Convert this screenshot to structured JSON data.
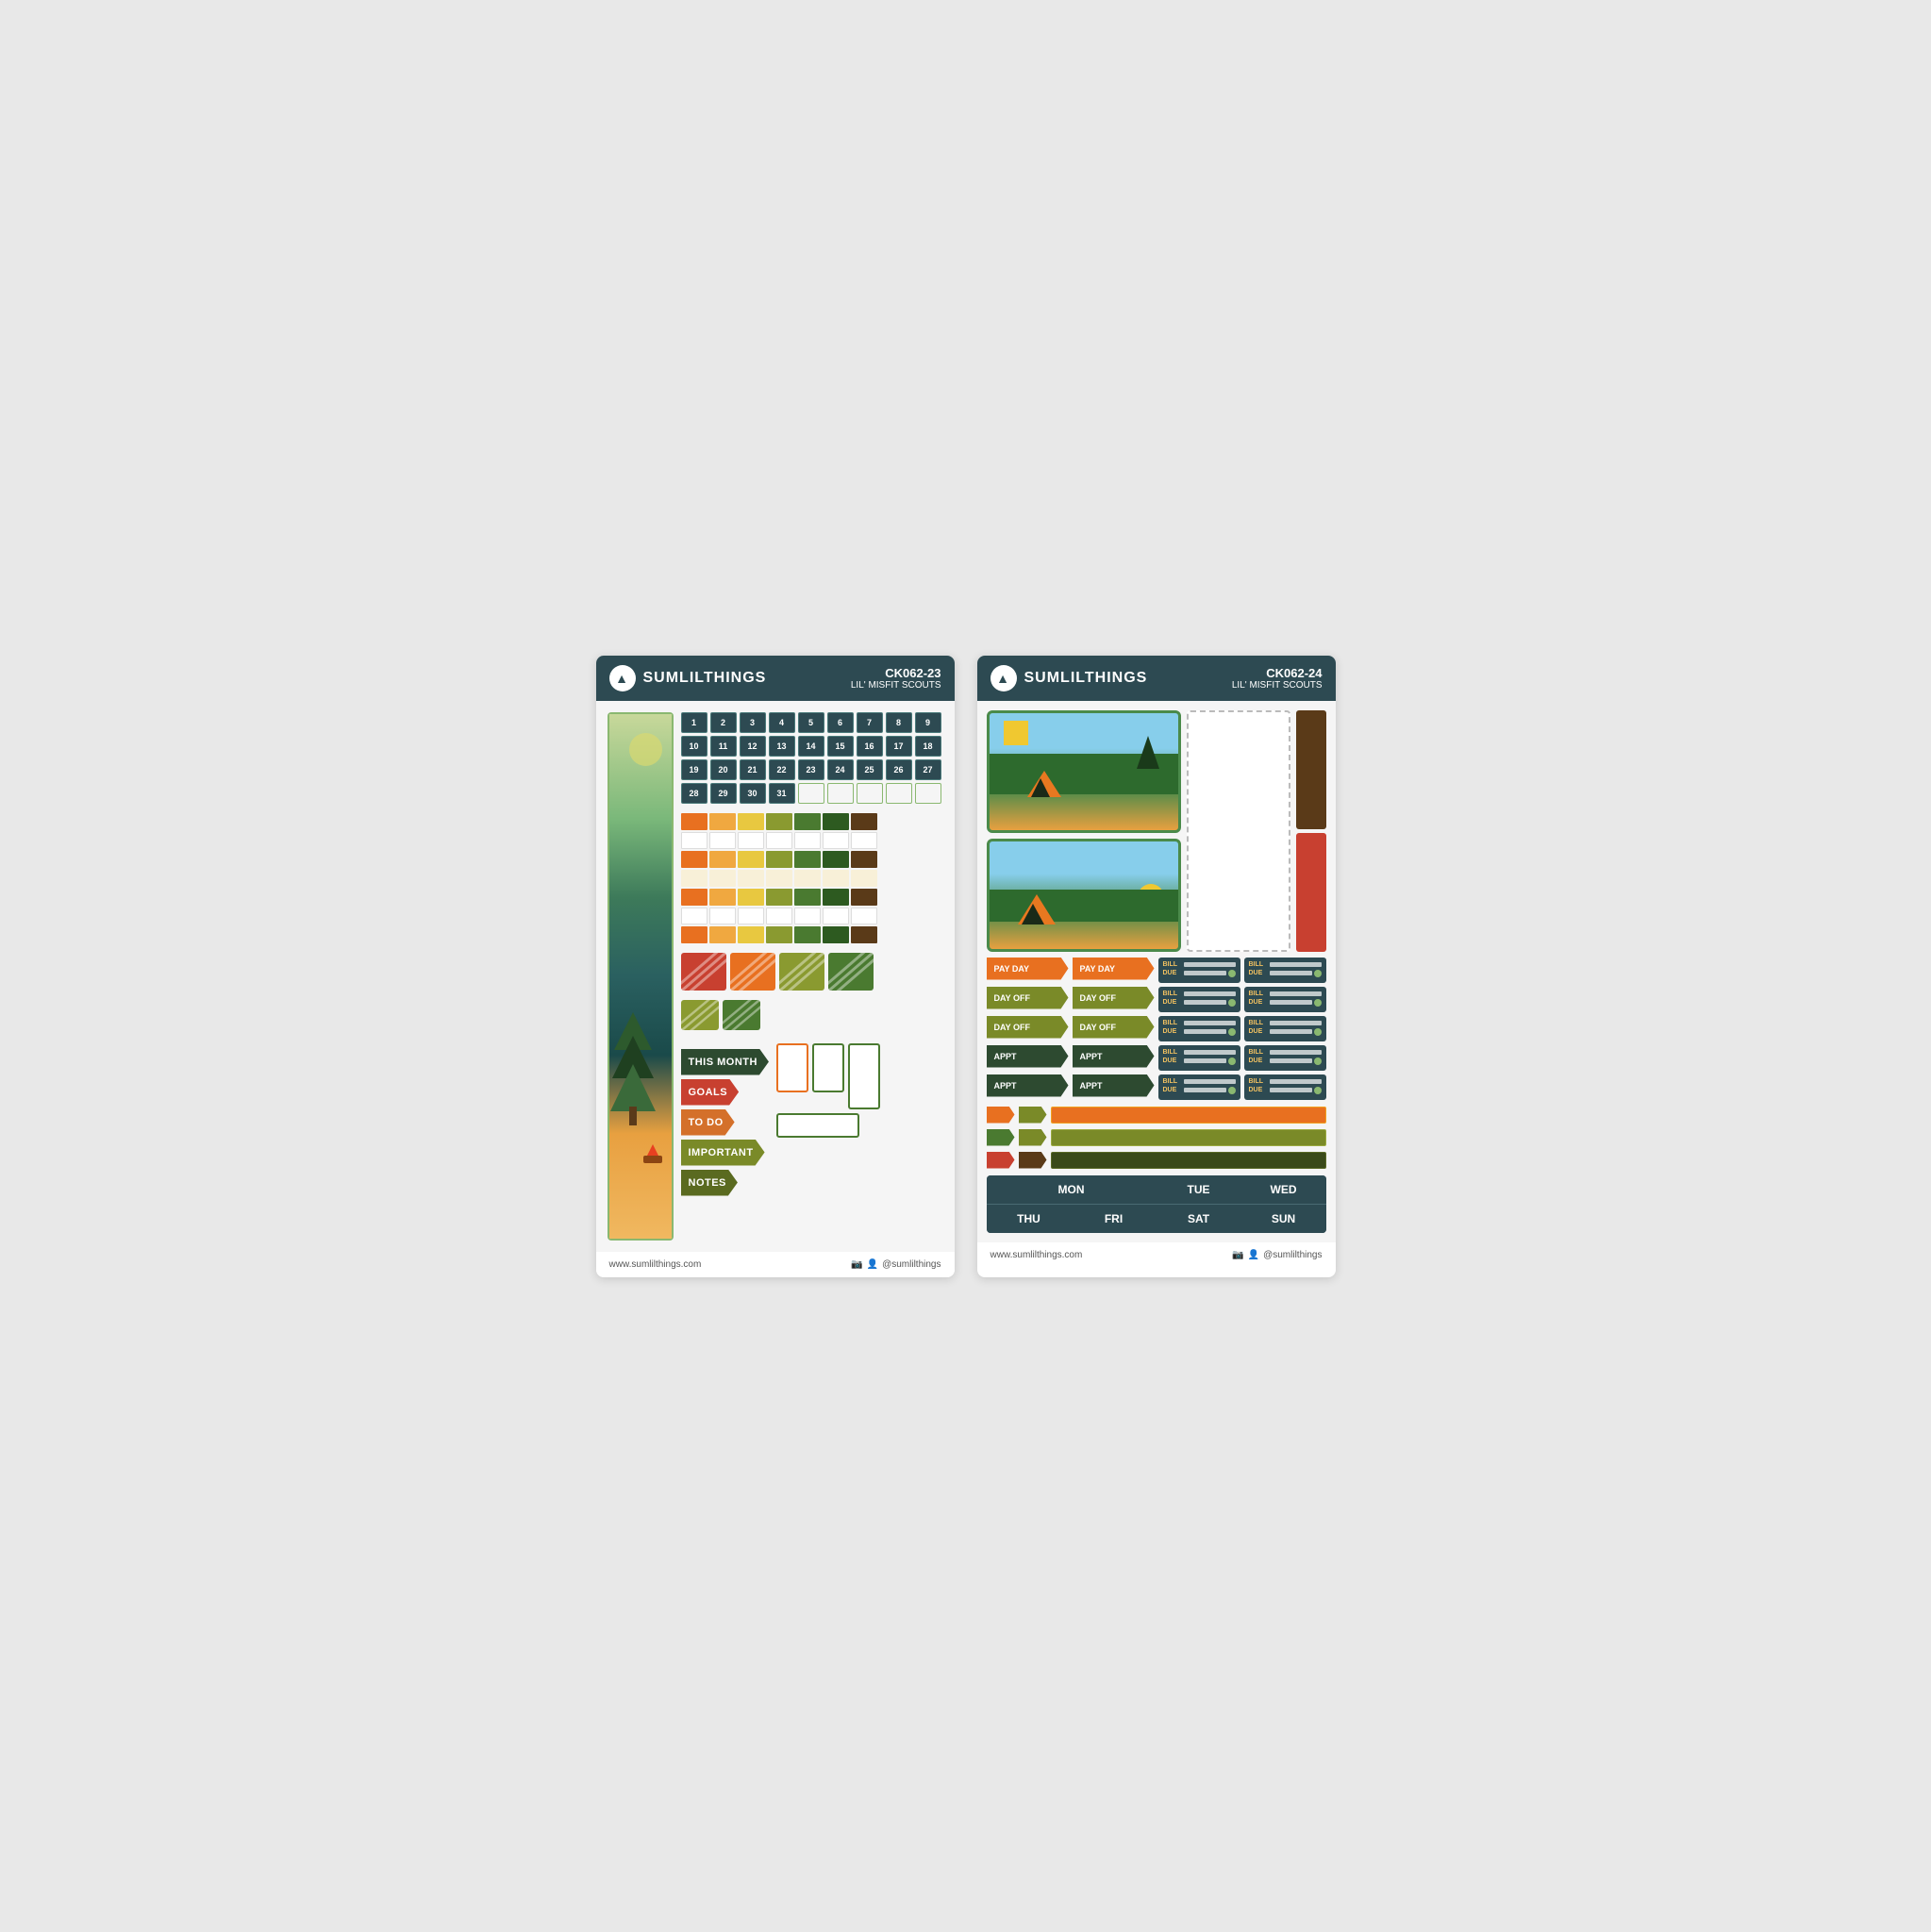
{
  "sheet1": {
    "header": {
      "brand": "SUMLILTHINGS",
      "code": "CK062-23",
      "subtitle": "LIL' MISFIT SCOUTS"
    },
    "numbers": [
      [
        1,
        2,
        3,
        4,
        5,
        6,
        7,
        8,
        9
      ],
      [
        10,
        11,
        12,
        13,
        14,
        15,
        16,
        17,
        18
      ],
      [
        19,
        20,
        21,
        22,
        23,
        24,
        25,
        26,
        27
      ],
      [
        28,
        29,
        30,
        31,
        "",
        "",
        "",
        "",
        ""
      ]
    ],
    "flag_labels": [
      {
        "text": "THIS MONTH",
        "color": "darkgreen"
      },
      {
        "text": "GOALS",
        "color": "red"
      },
      {
        "text": "TO DO",
        "color": "orange"
      },
      {
        "text": "IMPORTANT",
        "color": "olive"
      },
      {
        "text": "NOTES",
        "color": "darkolive"
      }
    ],
    "footer": {
      "website": "www.sumlilthings.com",
      "social": "@sumlilthings"
    }
  },
  "sheet2": {
    "header": {
      "brand": "SUMLILTHINGS",
      "code": "CK062-24",
      "subtitle": "LIL' MISFIT SCOUTS"
    },
    "event_flags": [
      {
        "text": "PAY DAY"
      },
      {
        "text": "PAY DAY"
      },
      {
        "text": "DAY OFF"
      },
      {
        "text": "DAY OFF"
      },
      {
        "text": "DAY OFF"
      },
      {
        "text": "DAY OFF"
      },
      {
        "text": "APPT"
      },
      {
        "text": "APPT"
      },
      {
        "text": "APPT"
      },
      {
        "text": "APPT"
      }
    ],
    "days": {
      "top": [
        "MON",
        "TUE",
        "WED"
      ],
      "bottom": [
        "THU",
        "FRI",
        "SAT",
        "SUN"
      ]
    },
    "footer": {
      "website": "www.sumlilthings.com",
      "social": "@sumlilthings"
    }
  }
}
